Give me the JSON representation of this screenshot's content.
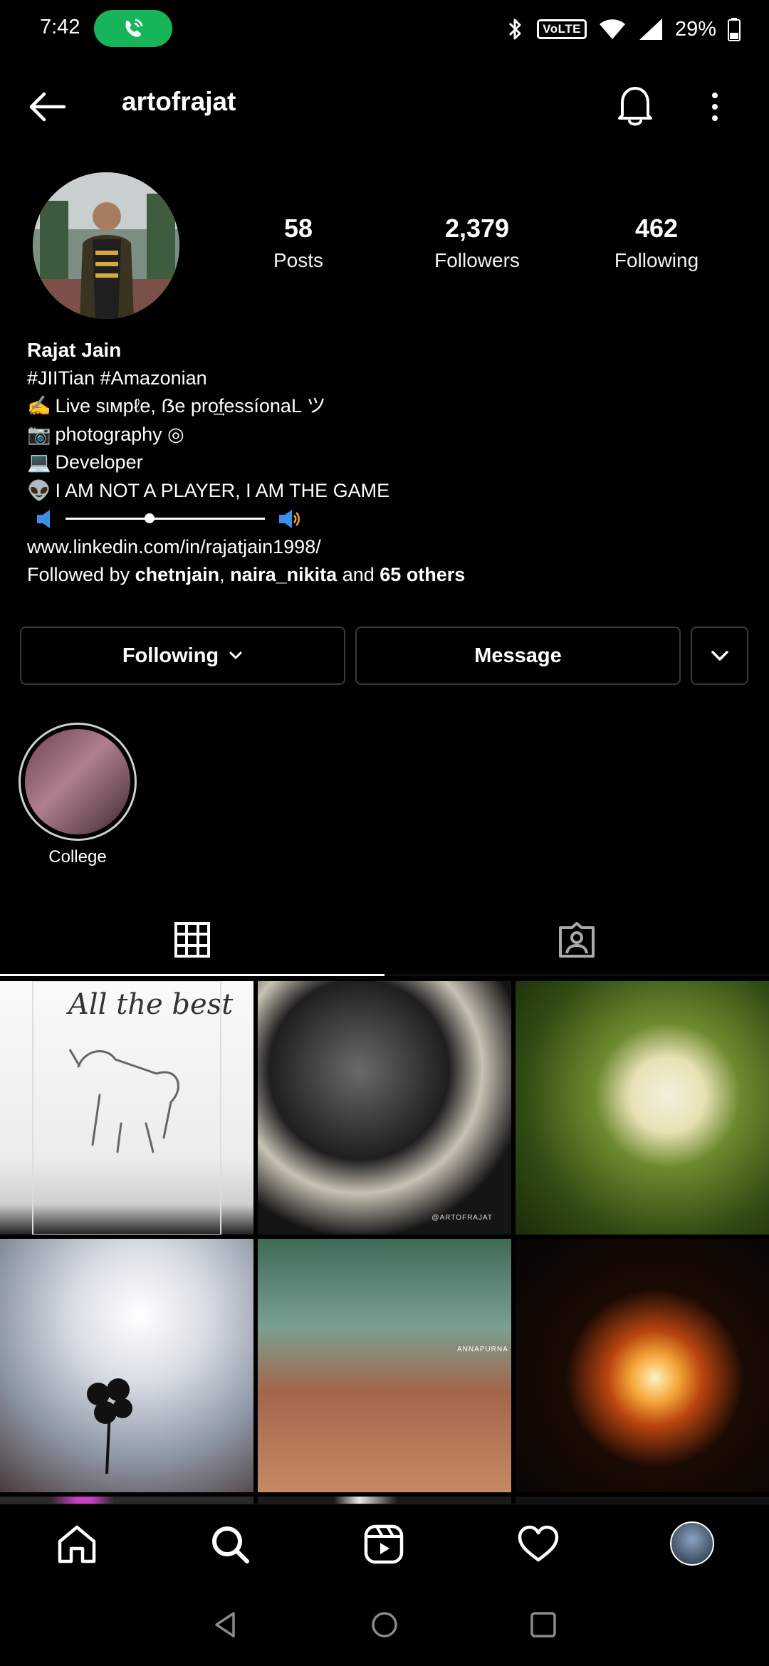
{
  "status_bar": {
    "time": "7:42",
    "network_badge": "VoLTE",
    "battery": "29%"
  },
  "header": {
    "username": "artofrajat"
  },
  "profile": {
    "stats": [
      {
        "value": "58",
        "label": "Posts"
      },
      {
        "value": "2,379",
        "label": "Followers"
      },
      {
        "value": "462",
        "label": "Following"
      }
    ],
    "name": "Rajat Jain",
    "bio_lines": [
      {
        "icon": "",
        "text": "#JIITian #Amazonian"
      },
      {
        "icon": "✍️",
        "text": "Live sιмpℓe, ẞe pro͢fessíonaL ツ"
      },
      {
        "icon": "📷",
        "text": "photography ◎"
      },
      {
        "icon": "💻",
        "text": "Developer"
      },
      {
        "icon": "👽",
        "text": "I AM NOT A PLAYER, I AM THE GAME"
      }
    ],
    "volume_level": 0.42,
    "link": "www.linkedin.com/in/rajatjain1998/",
    "followed_by": {
      "prefix": "Followed by ",
      "user1": "chetnjain",
      "separator": ", ",
      "user2": "naira_nikita",
      "and_text": " and ",
      "others": "65 others"
    }
  },
  "actions": {
    "following_label": "Following",
    "message_label": "Message"
  },
  "highlights": [
    {
      "label": "College"
    }
  ],
  "grid_posts": [
    {
      "overlay_text": "All the best",
      "signature": ""
    },
    {
      "overlay_text": "",
      "signature": "@ARTOFRAJAT"
    },
    {
      "overlay_text": "",
      "signature": ""
    },
    {
      "overlay_text": "",
      "signature": ""
    },
    {
      "overlay_text": "ANNAPURNA",
      "signature": ""
    },
    {
      "overlay_text": "",
      "signature": ""
    }
  ],
  "bottom_nav": {
    "items": [
      "home-icon",
      "search-icon",
      "reels-icon",
      "heart-icon",
      "profile-avatar"
    ]
  },
  "colors": {
    "background": "#000000",
    "call_pill": "#17b55a",
    "button_border": "#3a3a3a"
  }
}
